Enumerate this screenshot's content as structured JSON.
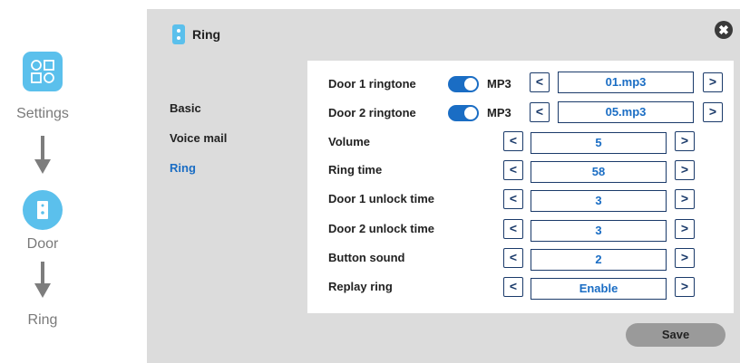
{
  "flow": {
    "settings_label": "Settings",
    "door_label": "Door",
    "ring_label": "Ring"
  },
  "panel": {
    "title": "Ring",
    "close_glyph": "✖"
  },
  "nav": {
    "items": [
      {
        "label": "Basic"
      },
      {
        "label": "Voice mail"
      },
      {
        "label": "Ring"
      }
    ]
  },
  "rows": [
    {
      "label": "Door 1 ringtone",
      "toggle_on": true,
      "format": "MP3",
      "value": "01.mp3"
    },
    {
      "label": "Door 2 ringtone",
      "toggle_on": true,
      "format": "MP3",
      "value": "05.mp3"
    },
    {
      "label": "Volume",
      "value": "5"
    },
    {
      "label": "Ring time",
      "value": "58"
    },
    {
      "label": "Door 1 unlock time",
      "value": "3"
    },
    {
      "label": "Door 2 unlock time",
      "value": "3"
    },
    {
      "label": "Button sound",
      "value": "2"
    },
    {
      "label": "Replay ring",
      "value": "Enable"
    }
  ],
  "glyphs": {
    "prev": "<",
    "next": ">"
  },
  "save_label": "Save",
  "icons": {
    "settings": "grid-settings-icon",
    "door": "door-icon",
    "ring": "doorbell-icon"
  },
  "colors": {
    "accent": "#5bc0ec",
    "value_text": "#1a6dc4",
    "toggle_on": "#1a6dc4"
  }
}
